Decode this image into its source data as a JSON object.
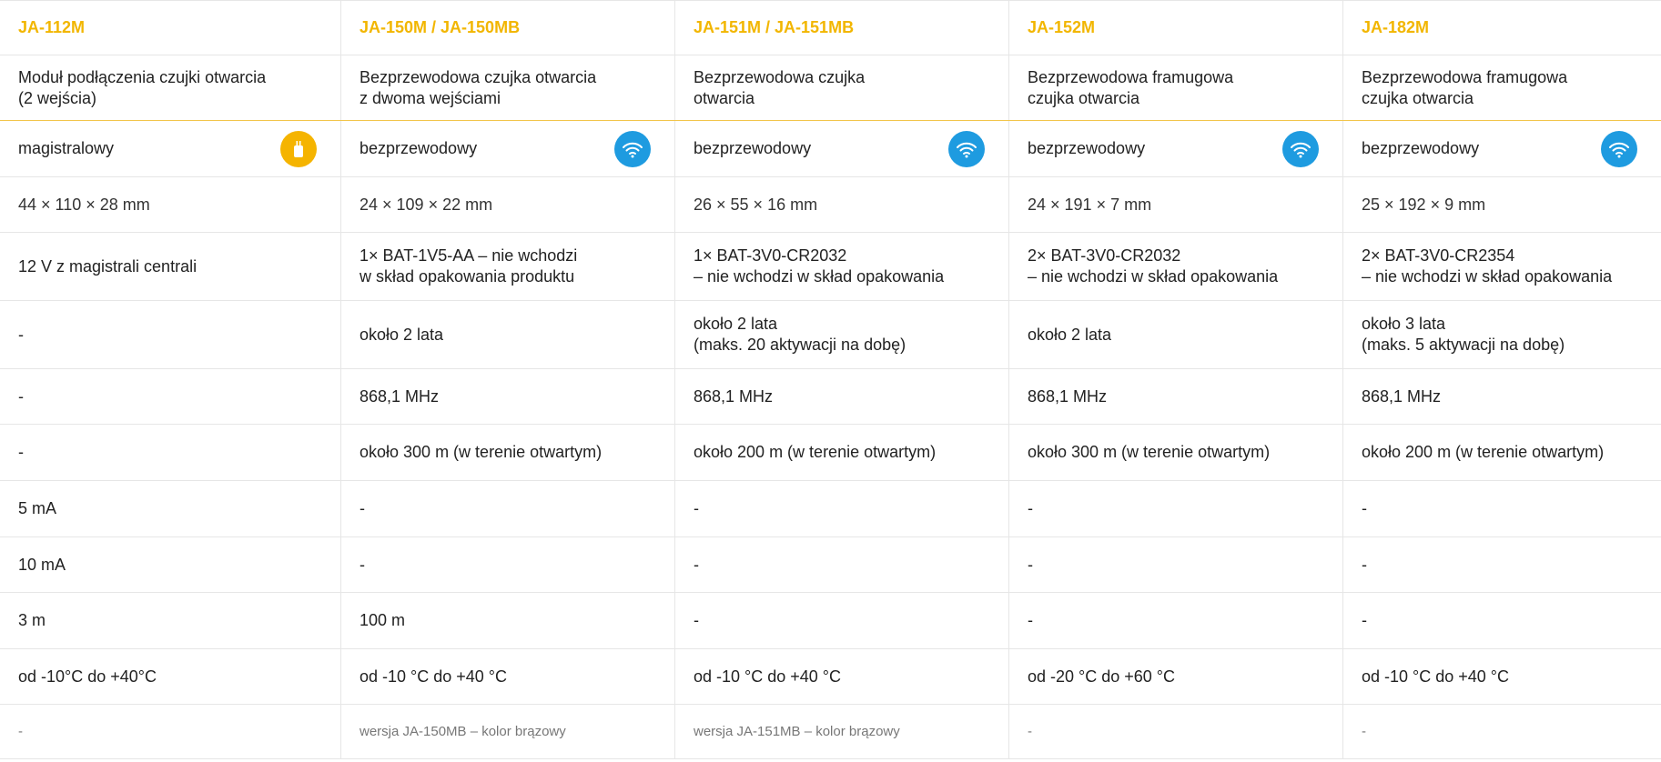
{
  "products": [
    {
      "model": "JA-112M",
      "description": [
        "Moduł podłączenia czujki otwarcia",
        "(2 wejścia)"
      ],
      "type": "magistralowy",
      "type_icon": "bus-wired-icon",
      "dimensions": "44 × 110 × 28 mm",
      "power": [
        "12 V z magistrali centrali"
      ],
      "battery_life": [
        "-"
      ],
      "frequency": "-",
      "range": "-",
      "standby_current": "5 mA",
      "alarm_current": "10 mA",
      "cable_length": "3 m",
      "temperature": "od -10°C do +40°C",
      "note": "-"
    },
    {
      "model": "JA-150M / JA-150MB",
      "description": [
        "Bezprzewodowa czujka otwarcia",
        "z dwoma wejściami"
      ],
      "type": "bezprzewodowy",
      "type_icon": "wireless-icon",
      "dimensions": "24 × 109 × 22 mm",
      "power": [
        "1× BAT-1V5-AA – nie wchodzi",
        "w skład opakowania produktu"
      ],
      "battery_life": [
        "około 2 lata"
      ],
      "frequency": "868,1 MHz",
      "range": "około 300 m (w terenie otwartym)",
      "standby_current": "-",
      "alarm_current": "-",
      "cable_length": "100 m",
      "temperature": "od -10 °C do +40 °C",
      "note": "wersja JA-150MB – kolor brązowy"
    },
    {
      "model": "JA-151M / JA-151MB",
      "description": [
        "Bezprzewodowa czujka",
        "otwarcia"
      ],
      "type": "bezprzewodowy",
      "type_icon": "wireless-icon",
      "dimensions": "26 × 55 × 16 mm",
      "power": [
        "1× BAT-3V0-CR2032",
        "– nie wchodzi w skład opakowania"
      ],
      "battery_life": [
        "około 2 lata",
        "(maks. 20 aktywacji na dobę)"
      ],
      "frequency": "868,1 MHz",
      "range": "około 200 m (w terenie otwartym)",
      "standby_current": "-",
      "alarm_current": "-",
      "cable_length": "-",
      "temperature": "od -10 °C do +40 °C",
      "note": "wersja JA-151MB – kolor brązowy"
    },
    {
      "model": "JA-152M",
      "description": [
        "Bezprzewodowa framugowa",
        "czujka otwarcia"
      ],
      "type": "bezprzewodowy",
      "type_icon": "wireless-icon",
      "dimensions": "24 × 191 × 7 mm",
      "power": [
        "2× BAT-3V0-CR2032",
        "– nie wchodzi w skład opakowania"
      ],
      "battery_life": [
        "około 2 lata"
      ],
      "frequency": "868,1 MHz",
      "range": "około 300 m (w terenie otwartym)",
      "standby_current": "-",
      "alarm_current": "-",
      "cable_length": "-",
      "temperature": "od -20 °C do +60 °C",
      "note": "-"
    },
    {
      "model": "JA-182M",
      "description": [
        "Bezprzewodowa framugowa",
        "czujka otwarcia"
      ],
      "type": "bezprzewodowy",
      "type_icon": "wireless-icon",
      "dimensions": "25 × 192 × 9 mm",
      "power": [
        "2× BAT-3V0-CR2354",
        "– nie wchodzi w skład opakowania"
      ],
      "battery_life": [
        "około 3 lata",
        "(maks. 5 aktywacji na dobę)"
      ],
      "frequency": "868,1 MHz",
      "range": "około 200 m (w terenie otwartym)",
      "standby_current": "-",
      "alarm_current": "-",
      "cable_length": "-",
      "temperature": "od -10 °C do +40 °C",
      "note": "-"
    }
  ],
  "colors": {
    "accent": "#f2b600",
    "wired_icon_bg": "#f5b400",
    "wireless_icon_bg": "#1e9be0",
    "divider": "#e6e6e6"
  }
}
